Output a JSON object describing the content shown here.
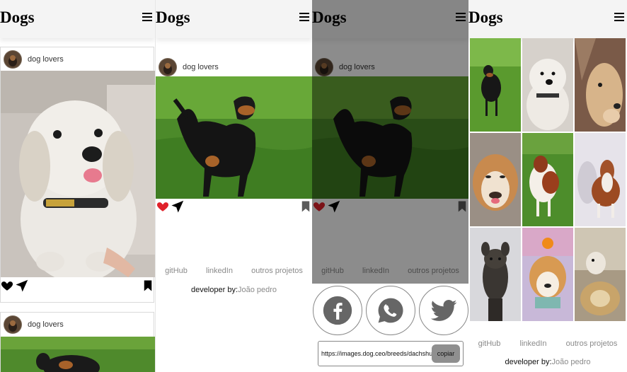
{
  "brand": "Dogs",
  "author": "dog lovers",
  "footer": {
    "links": [
      "gitHub",
      "linkedIn",
      "outros projetos"
    ],
    "developer_label": "developer by:",
    "developer_name": "João pedro"
  },
  "share": {
    "url": "https://images.dog.ceo/breeds/dachshund",
    "copy_label": "copiar",
    "networks": [
      "facebook",
      "whatsapp",
      "twitter"
    ]
  },
  "icons": {
    "menu": "hamburger-icon",
    "like": "heart-icon",
    "send": "paper-plane-icon",
    "save": "bookmark-icon"
  },
  "colors": {
    "header_bg": "#f4f4f4",
    "like_active": "#e0222b",
    "icon_dark": "#000000",
    "overlay": "rgba(0,0,0,0.45)",
    "muted_text": "#8a8a8a"
  },
  "panels": [
    {
      "view": "feed"
    },
    {
      "view": "post-detail",
      "liked": true
    },
    {
      "view": "share-dialog",
      "liked": true
    },
    {
      "view": "gallery",
      "photo_count": 9
    }
  ]
}
